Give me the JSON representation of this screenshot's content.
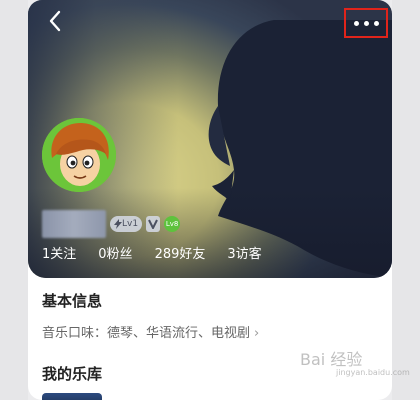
{
  "nav": {
    "back_icon": "chevron-left-icon",
    "more_icon": "more-dots-icon",
    "highlight_color": "#e0241b"
  },
  "profile": {
    "level_badge": "Lv1",
    "lv_badge": "Lv8"
  },
  "stats": [
    {
      "label": "1关注"
    },
    {
      "label": "0粉丝"
    },
    {
      "label": "289好友"
    },
    {
      "label": "3访客"
    }
  ],
  "basic_info": {
    "title": "基本信息",
    "music_taste_label": "音乐口味：",
    "music_taste_values": "德琴、华语流行、电视剧",
    "chevron": "›"
  },
  "library": {
    "title": "我的乐库"
  },
  "watermark": {
    "text": "Bai 经验",
    "sub": "jingyan.baidu.com"
  }
}
